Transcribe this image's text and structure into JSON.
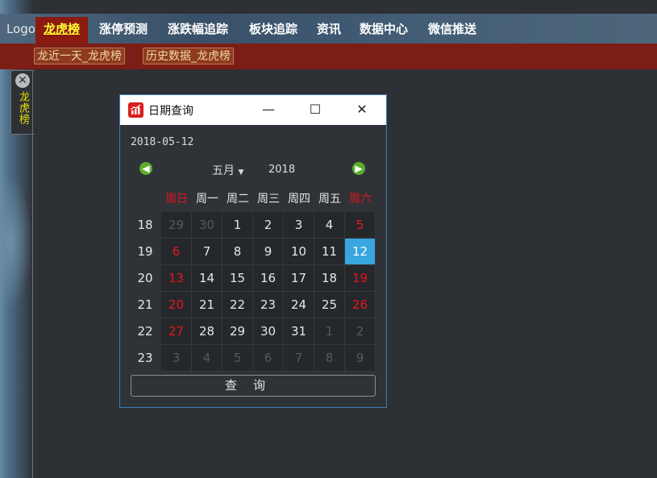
{
  "header": {
    "logo": "Logo",
    "nav": [
      "龙虎榜",
      "涨停预测",
      "涨跌幅追踪",
      "板块追踪",
      "资讯",
      "数据中心",
      "微信推送"
    ],
    "active_index": 0
  },
  "subnav": [
    "龙近一天_龙虎榜",
    "历史数据_龙虎榜"
  ],
  "side_tab": {
    "label": "龙虎榜"
  },
  "dialog": {
    "title": "日期查询",
    "selected_date": "2018-05-12",
    "month": "五月",
    "year": "2018",
    "weekdays": [
      "周日",
      "周一",
      "周二",
      "周三",
      "周四",
      "周五",
      "周六"
    ],
    "weeks": [
      {
        "num": "18",
        "days": [
          [
            "29",
            "o"
          ],
          [
            "30",
            "o"
          ],
          [
            "1",
            "n"
          ],
          [
            "2",
            "n"
          ],
          [
            "3",
            "n"
          ],
          [
            "4",
            "n"
          ],
          [
            "5",
            "w"
          ]
        ]
      },
      {
        "num": "19",
        "days": [
          [
            "6",
            "w"
          ],
          [
            "7",
            "n"
          ],
          [
            "8",
            "n"
          ],
          [
            "9",
            "n"
          ],
          [
            "10",
            "n"
          ],
          [
            "11",
            "n"
          ],
          [
            "12",
            "s"
          ]
        ]
      },
      {
        "num": "20",
        "days": [
          [
            "13",
            "w"
          ],
          [
            "14",
            "n"
          ],
          [
            "15",
            "n"
          ],
          [
            "16",
            "n"
          ],
          [
            "17",
            "n"
          ],
          [
            "18",
            "n"
          ],
          [
            "19",
            "w"
          ]
        ]
      },
      {
        "num": "21",
        "days": [
          [
            "20",
            "w"
          ],
          [
            "21",
            "n"
          ],
          [
            "22",
            "n"
          ],
          [
            "23",
            "n"
          ],
          [
            "24",
            "n"
          ],
          [
            "25",
            "n"
          ],
          [
            "26",
            "w"
          ]
        ]
      },
      {
        "num": "22",
        "days": [
          [
            "27",
            "w"
          ],
          [
            "28",
            "n"
          ],
          [
            "29",
            "n"
          ],
          [
            "30",
            "n"
          ],
          [
            "31",
            "n"
          ],
          [
            "1",
            "o"
          ],
          [
            "2",
            "o"
          ]
        ]
      },
      {
        "num": "23",
        "days": [
          [
            "3",
            "o"
          ],
          [
            "4",
            "o"
          ],
          [
            "5",
            "o"
          ],
          [
            "6",
            "o"
          ],
          [
            "7",
            "o"
          ],
          [
            "8",
            "o"
          ],
          [
            "9",
            "o"
          ]
        ]
      }
    ],
    "query_button": "查询"
  },
  "colors": {
    "accent_red": "#e8141c",
    "selected_bg": "#3aa6e0",
    "other_month": "#55595e",
    "normal_day": "#e6e6e6",
    "nav_active_text": "#ffff33"
  }
}
